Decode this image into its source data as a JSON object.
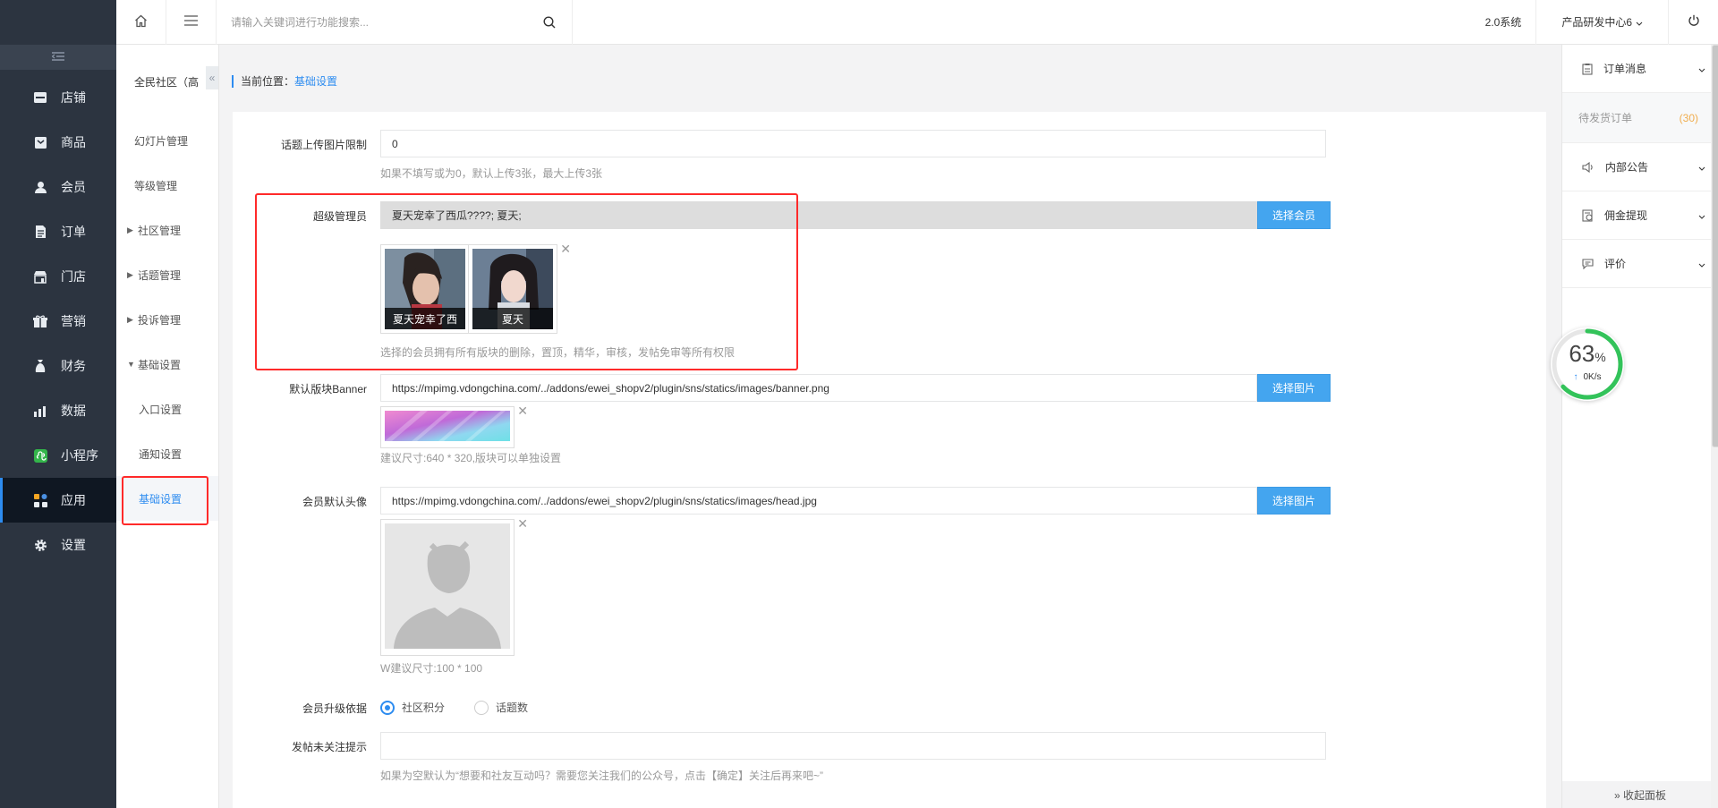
{
  "sidebar": {
    "items": [
      {
        "label": "店铺",
        "icon": "store-icon"
      },
      {
        "label": "商品",
        "icon": "goods-icon"
      },
      {
        "label": "会员",
        "icon": "member-icon"
      },
      {
        "label": "订单",
        "icon": "order-icon"
      },
      {
        "label": "门店",
        "icon": "shop-icon"
      },
      {
        "label": "营销",
        "icon": "marketing-icon"
      },
      {
        "label": "财务",
        "icon": "finance-icon"
      },
      {
        "label": "数据",
        "icon": "data-icon"
      },
      {
        "label": "小程序",
        "icon": "miniprogram-icon"
      },
      {
        "label": "应用",
        "icon": "apps-icon"
      },
      {
        "label": "设置",
        "icon": "gear-icon"
      }
    ],
    "active_index": 9
  },
  "subnav": {
    "title": "全民社区（高",
    "items": [
      "幻灯片管理",
      "等级管理",
      "社区管理",
      "话题管理",
      "投诉管理",
      "基础设置",
      "入口设置",
      "通知设置",
      "基础设置"
    ]
  },
  "topbar": {
    "search_placeholder": "请输入关键词进行功能搜索...",
    "version": "2.0系统",
    "org": "产品研发中心6"
  },
  "breadcrumb": {
    "prefix": "当前位置：",
    "current": "基础设置"
  },
  "form": {
    "upload_limit": {
      "label": "话题上传图片限制",
      "value": "0",
      "help": "如果不填写或为0，默认上传3张，最大上传3张"
    },
    "super_admin": {
      "label": "超级管理员",
      "value": "夏天宠幸了西瓜????; 夏天;",
      "button": "选择会员",
      "members": [
        "夏天宠幸了西",
        "夏天"
      ],
      "help": "选择的会员拥有所有版块的删除，置顶，精华，审核，发帖免审等所有权限"
    },
    "banner": {
      "label": "默认版块Banner",
      "value": "https://mpimg.vdongchina.com/../addons/ewei_shopv2/plugin/sns/statics/images/banner.png",
      "button": "选择图片",
      "help": "建议尺寸:640 * 320,版块可以单独设置"
    },
    "avatar": {
      "label": "会员默认头像",
      "value": "https://mpimg.vdongchina.com/../addons/ewei_shopv2/plugin/sns/statics/images/head.jpg",
      "button": "选择图片",
      "help": "W建议尺寸:100 * 100"
    },
    "upgrade": {
      "label": "会员升级依据",
      "options": [
        "社区积分",
        "话题数"
      ],
      "selected": 0
    },
    "follow_tip": {
      "label": "发帖未关注提示",
      "value": "",
      "help": "如果为空默认为“想要和社友互动吗？需要您关注我们的公众号，点击【确定】关注后再来吧~”"
    }
  },
  "rightpanel": {
    "order_msg": "订单消息",
    "pending_label": "待发货订单",
    "pending_count": "(30)",
    "notice": "内部公告",
    "commission": "佣金提现",
    "review": "评价",
    "collapse": "» 收起面板"
  },
  "speed": {
    "percent": "63",
    "percent_unit": "%",
    "rate": "0K/s",
    "fraction": 0.63
  },
  "colors": {
    "accent": "#2d8cf0",
    "highlight": "#ff2a2a",
    "button": "#44a5ef",
    "sidebar": "#2c3440"
  }
}
